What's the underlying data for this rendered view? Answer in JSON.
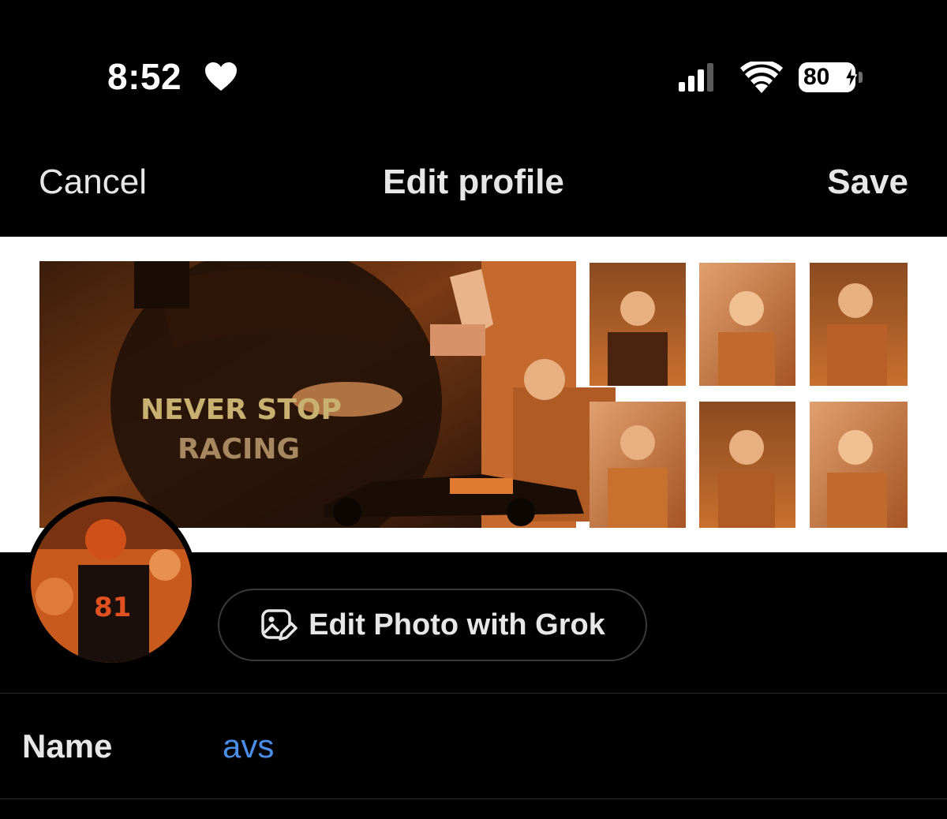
{
  "status_bar": {
    "time": "8:52",
    "battery_level": "80",
    "icons": [
      "heart-icon",
      "cellular-signal-icon",
      "wifi-icon",
      "battery-charging-icon"
    ]
  },
  "nav": {
    "cancel_label": "Cancel",
    "title": "Edit profile",
    "save_label": "Save"
  },
  "banner": {
    "overlay_text_line1": "NEVER STOP",
    "overlay_text_line2": "RACING"
  },
  "grok_button": {
    "label": "Edit Photo with Grok",
    "icon": "image-edit-icon"
  },
  "fields": {
    "name_label": "Name",
    "name_value": "avs"
  },
  "colors": {
    "background": "#000000",
    "text": "#e7e7e7",
    "link_value": "#4a8ee8",
    "banner_tint": "#c8642a"
  }
}
